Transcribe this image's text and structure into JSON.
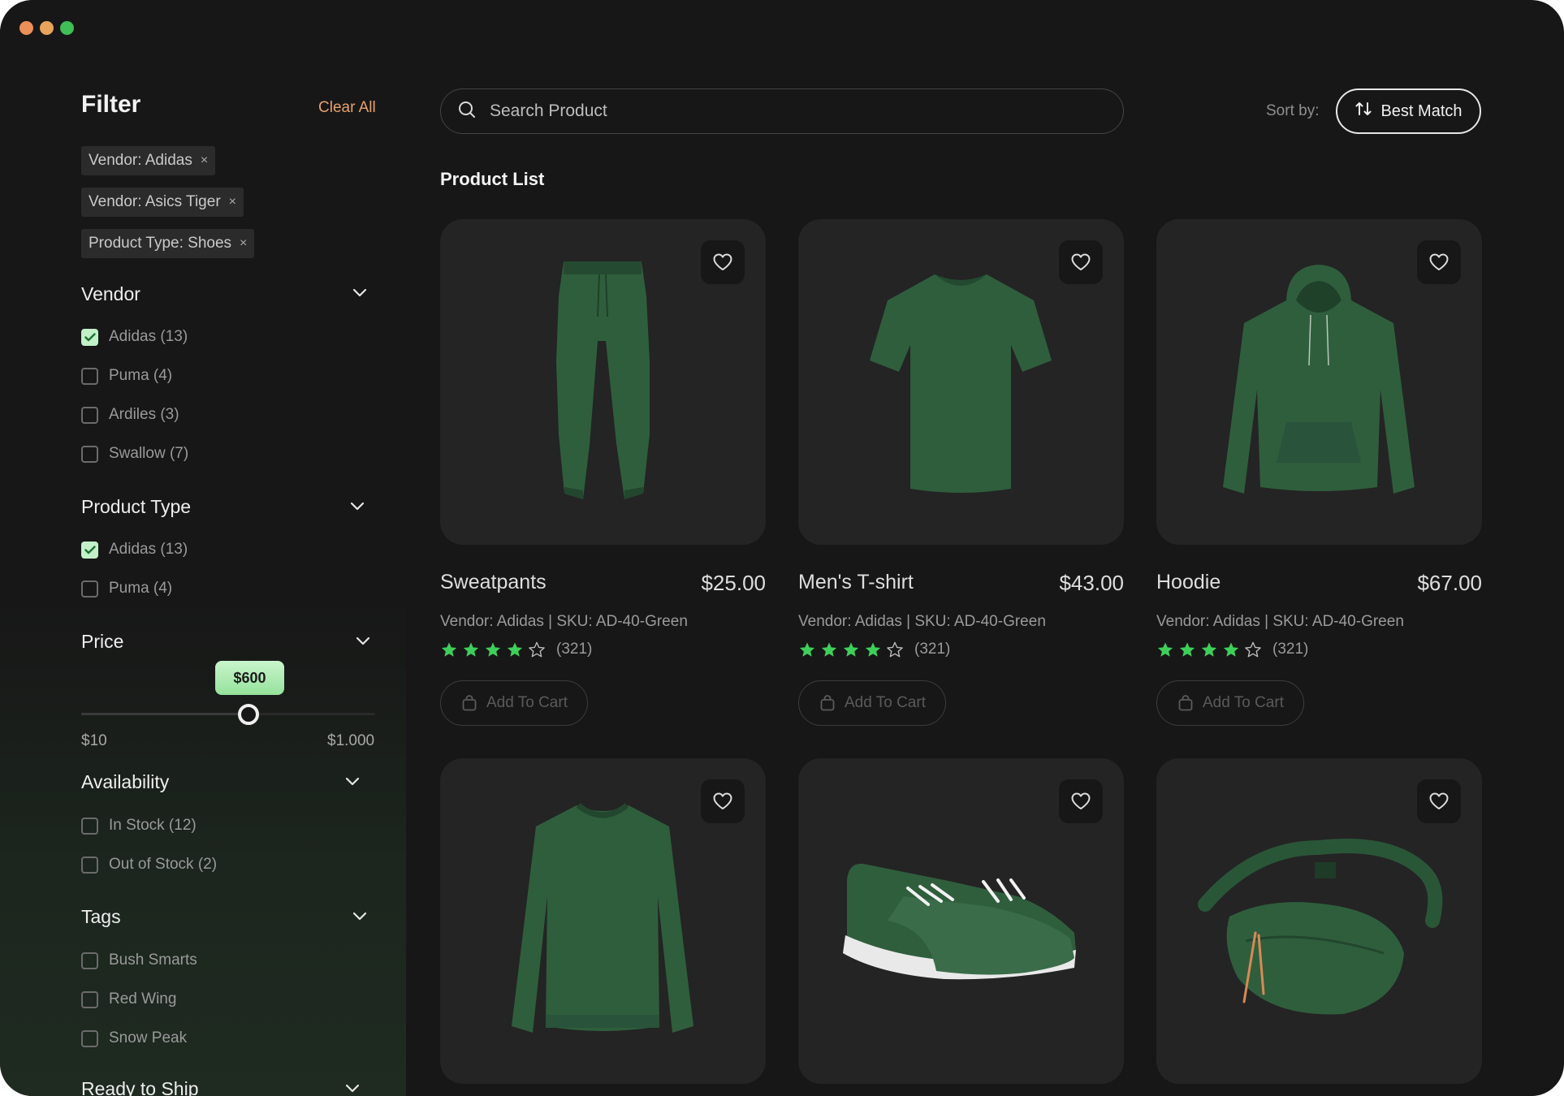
{
  "window": {
    "controls": [
      "close",
      "minimize",
      "maximize"
    ]
  },
  "colors": {
    "accent": "#e6a26e",
    "star": "#3ecf5a",
    "check_bg": "#c2f1c7",
    "product_green": "#2f5e3d"
  },
  "filter": {
    "title": "Filter",
    "clear_all": "Clear All",
    "chips": [
      "Vendor: Adidas",
      "Vendor: Asics Tiger",
      "Product Type: Shoes"
    ],
    "chip_remove": "×",
    "vendor": {
      "title": "Vendor",
      "options": [
        {
          "label": "Adidas (13)",
          "checked": true
        },
        {
          "label": "Puma (4)",
          "checked": false
        },
        {
          "label": "Ardiles (3)",
          "checked": false
        },
        {
          "label": "Swallow (7)",
          "checked": false
        }
      ]
    },
    "product_type": {
      "title": "Product Type",
      "options": [
        {
          "label": "Adidas (13)",
          "checked": true
        },
        {
          "label": "Puma (4)",
          "checked": false
        }
      ]
    },
    "price": {
      "title": "Price",
      "current": "$600",
      "min": "$10",
      "max": "$1.000",
      "fraction": 0.6
    },
    "availability": {
      "title": "Availability",
      "options": [
        {
          "label": "In Stock (12)",
          "checked": false
        },
        {
          "label": "Out of Stock (2)",
          "checked": false
        }
      ]
    },
    "tags": {
      "title": "Tags",
      "options": [
        {
          "label": "Bush Smarts",
          "checked": false
        },
        {
          "label": "Red Wing",
          "checked": false
        },
        {
          "label": "Snow Peak",
          "checked": false
        }
      ]
    },
    "ready_to_ship": {
      "title": "Ready to Ship"
    }
  },
  "search": {
    "placeholder": "Search Product"
  },
  "sort": {
    "label": "Sort by:",
    "value": "Best Match"
  },
  "product_list": {
    "title": "Product List",
    "products": [
      {
        "name": "Sweatpants",
        "price": "$25.00",
        "meta": "Vendor: Adidas | SKU: AD-40-Green",
        "rating": 4,
        "reviews": "(321)",
        "cart": "Add To Cart",
        "icon": "sweatpants"
      },
      {
        "name": "Men's T-shirt",
        "price": "$43.00",
        "meta": "Vendor: Adidas | SKU: AD-40-Green",
        "rating": 4,
        "reviews": "(321)",
        "cart": "Add To Cart",
        "icon": "tshirt"
      },
      {
        "name": "Hoodie",
        "price": "$67.00",
        "meta": "Vendor: Adidas | SKU: AD-40-Green",
        "rating": 4,
        "reviews": "(321)",
        "cart": "Add To Cart",
        "icon": "hoodie"
      },
      {
        "icon": "sweatshirt"
      },
      {
        "icon": "sneakers"
      },
      {
        "icon": "belt-bag"
      }
    ]
  }
}
